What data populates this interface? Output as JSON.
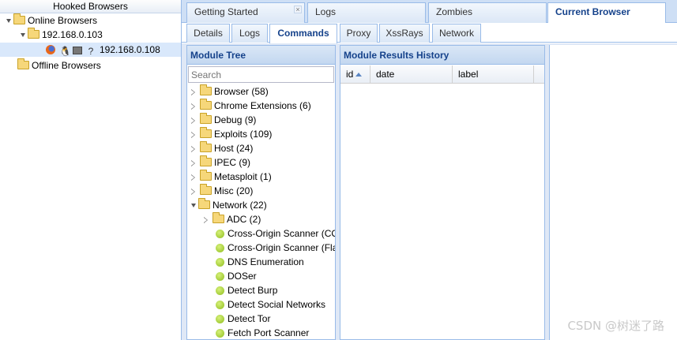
{
  "hooked_browsers": {
    "title": "Hooked Browsers",
    "online_label": "Online Browsers",
    "host_ip": "192.168.0.103",
    "browser_ip": "192.168.0.108",
    "browser_icons": [
      "firefox-icon",
      "linux-icon",
      "hardware-icon",
      "unknown-icon"
    ],
    "offline_label": "Offline Browsers"
  },
  "top_tabs": {
    "getting_started": "Getting Started",
    "close_glyph": "×",
    "logs": "Logs",
    "zombies": "Zombies",
    "current_browser": "Current Browser"
  },
  "sub_tabs": {
    "details": "Details",
    "logs": "Logs",
    "commands": "Commands",
    "proxy": "Proxy",
    "xssrays": "XssRays",
    "network": "Network"
  },
  "module_tree": {
    "title": "Module Tree",
    "search_placeholder": "Search",
    "categories": [
      "Browser (58)",
      "Chrome Extensions (6)",
      "Debug (9)",
      "Exploits (109)",
      "Host (24)",
      "IPEC (9)",
      "Metasploit (1)",
      "Misc (20)",
      "Network (22)"
    ],
    "network_children": {
      "subfolder": "ADC (2)",
      "modules": [
        "Cross-Origin Scanner (CORS)",
        "Cross-Origin Scanner (Flash)",
        "DNS Enumeration",
        "DOSer",
        "Detect Burp",
        "Detect Social Networks",
        "Detect Tor",
        "Fetch Port Scanner"
      ]
    }
  },
  "results": {
    "title": "Module Results History",
    "columns": [
      "id",
      "date",
      "label"
    ]
  },
  "watermark": "CSDN @树迷了路",
  "colors": {
    "header_text": "#15428b",
    "border": "#99bbe8",
    "tab_bar": "#cedff5",
    "selection": "#d9e8fb",
    "leaf_green": "#8fbe1e",
    "folder_yellow": "#f6d77a"
  }
}
